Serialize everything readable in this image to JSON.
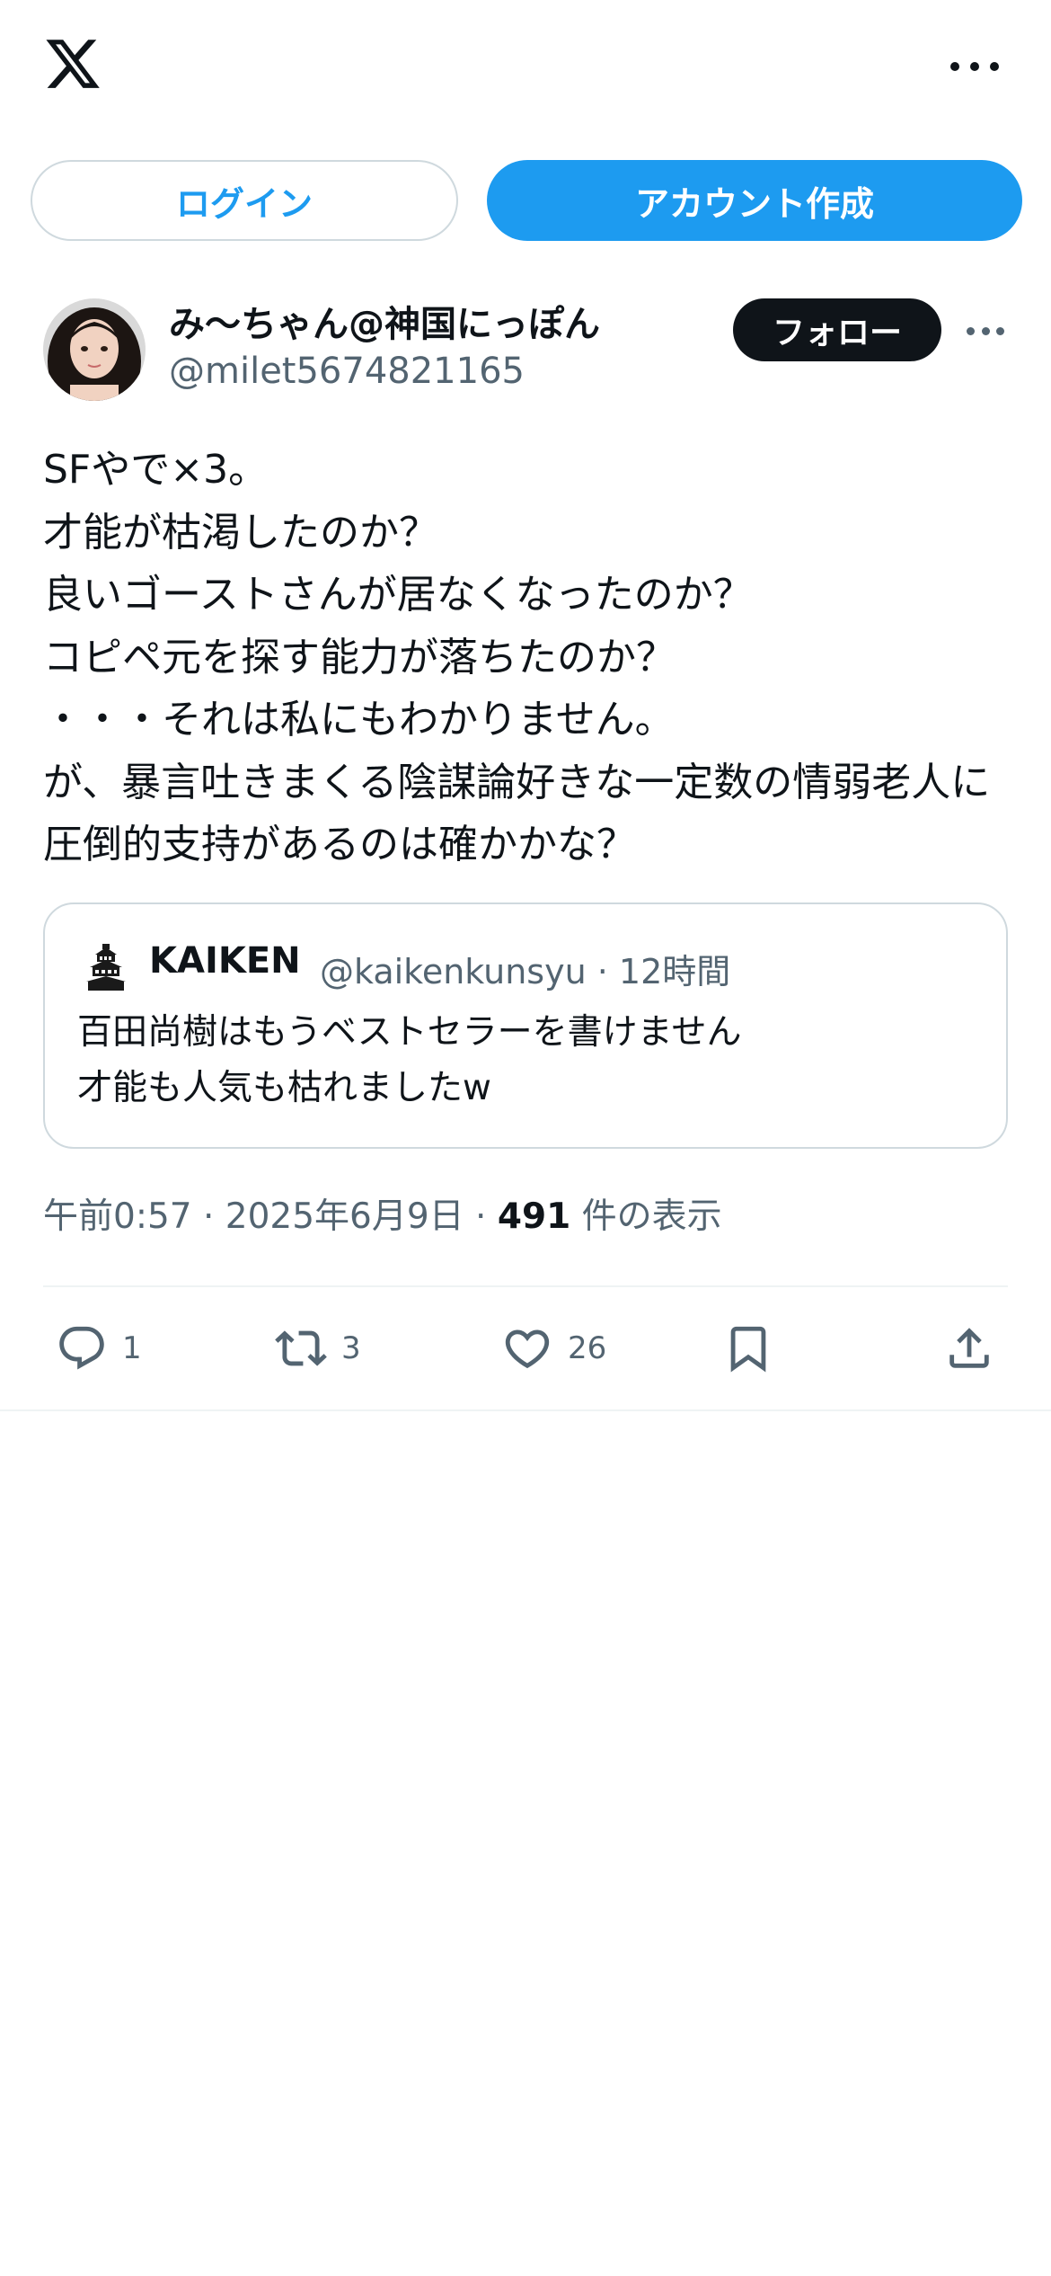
{
  "header": {
    "logo_icon": "x-logo-icon",
    "more_icon": "more-horizontal-icon"
  },
  "auth": {
    "login_label": "ログイン",
    "signup_label": "アカウント作成"
  },
  "post": {
    "author": {
      "display_name": "み〜ちゃん@神国にっぽん",
      "handle": "@milet5674821165",
      "avatar_icon": "profile-avatar"
    },
    "follow_label": "フォロー",
    "more_icon": "more-horizontal-icon",
    "text": "SFやで×3。\n才能が枯渇したのか？\n良いゴーストさんが居なくなったのか？\nコピペ元を探す能力が落ちたのか？\n・・・それは私にもわかりません。\nが、暴言吐きまくる陰謀論好きな一定数の情弱老人に圧倒的支持があるのは確かかな？",
    "quote": {
      "display_name": "KAIKEN",
      "handle_time": "@kaikenkunsyu · 12時間",
      "text": "百田尚樹はもうベストセラーを書けません\n才能も人気も枯れましたw"
    },
    "timestamp": "午前0:57 · 2025年6月9日 · ",
    "views_count": "491",
    "views_label": " 件の表示",
    "actions": {
      "reply_count": "1",
      "repost_count": "3",
      "like_count": "26"
    }
  },
  "colors": {
    "accent": "#1d9bf0",
    "text_primary": "#0f1419",
    "text_secondary": "#536471",
    "border": "#cfd9de",
    "follow_bg": "#0f1419"
  }
}
